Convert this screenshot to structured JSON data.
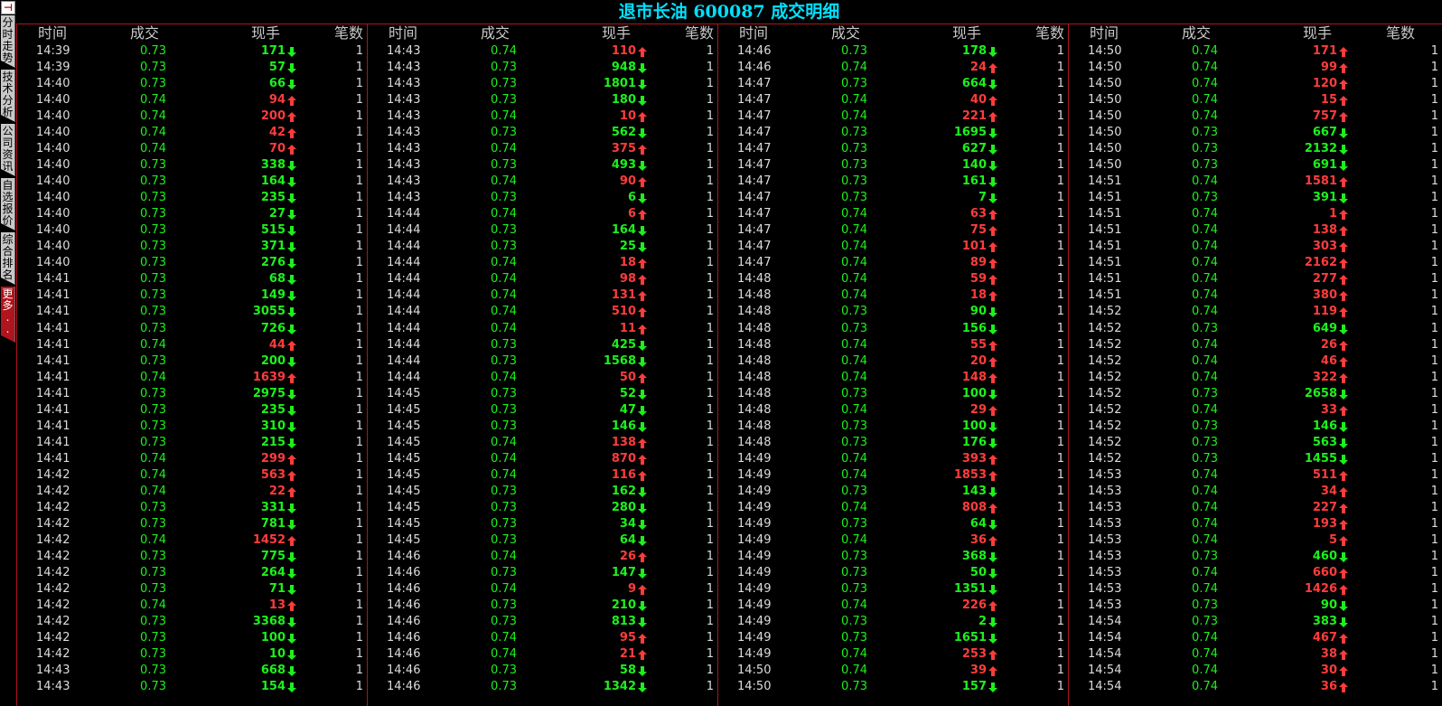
{
  "sidebar": {
    "tabs": [
      "分时走势",
      "技术分析",
      "公司资讯",
      "自选报价",
      "综合排名",
      "更多..."
    ]
  },
  "title": "退市长油 600087 成交明细",
  "headers": {
    "time": "时间",
    "price": "成交",
    "volume": "现手",
    "count": "笔数"
  },
  "colors": {
    "up": "#ff3c3c",
    "down": "#1df01d",
    "title": "#00e0ff",
    "separator": "#b0141c"
  },
  "columns": [
    [
      [
        "14:39",
        "0.73",
        "171",
        "down",
        "1"
      ],
      [
        "14:39",
        "0.73",
        "57",
        "down",
        "1"
      ],
      [
        "14:40",
        "0.73",
        "66",
        "down",
        "1"
      ],
      [
        "14:40",
        "0.74",
        "94",
        "up",
        "1"
      ],
      [
        "14:40",
        "0.74",
        "200",
        "up",
        "1"
      ],
      [
        "14:40",
        "0.74",
        "42",
        "up",
        "1"
      ],
      [
        "14:40",
        "0.74",
        "70",
        "up",
        "1"
      ],
      [
        "14:40",
        "0.73",
        "338",
        "down",
        "1"
      ],
      [
        "14:40",
        "0.73",
        "164",
        "down",
        "1"
      ],
      [
        "14:40",
        "0.73",
        "235",
        "down",
        "1"
      ],
      [
        "14:40",
        "0.73",
        "27",
        "down",
        "1"
      ],
      [
        "14:40",
        "0.73",
        "515",
        "down",
        "1"
      ],
      [
        "14:40",
        "0.73",
        "371",
        "down",
        "1"
      ],
      [
        "14:40",
        "0.73",
        "276",
        "down",
        "1"
      ],
      [
        "14:41",
        "0.73",
        "68",
        "down",
        "1"
      ],
      [
        "14:41",
        "0.73",
        "149",
        "down",
        "1"
      ],
      [
        "14:41",
        "0.73",
        "3055",
        "down",
        "1"
      ],
      [
        "14:41",
        "0.73",
        "726",
        "down",
        "1"
      ],
      [
        "14:41",
        "0.74",
        "44",
        "up",
        "1"
      ],
      [
        "14:41",
        "0.73",
        "200",
        "down",
        "1"
      ],
      [
        "14:41",
        "0.74",
        "1639",
        "up",
        "1"
      ],
      [
        "14:41",
        "0.73",
        "2975",
        "down",
        "1"
      ],
      [
        "14:41",
        "0.73",
        "235",
        "down",
        "1"
      ],
      [
        "14:41",
        "0.73",
        "310",
        "down",
        "1"
      ],
      [
        "14:41",
        "0.73",
        "215",
        "down",
        "1"
      ],
      [
        "14:41",
        "0.74",
        "299",
        "up",
        "1"
      ],
      [
        "14:42",
        "0.74",
        "563",
        "up",
        "1"
      ],
      [
        "14:42",
        "0.74",
        "22",
        "up",
        "1"
      ],
      [
        "14:42",
        "0.73",
        "331",
        "down",
        "1"
      ],
      [
        "14:42",
        "0.73",
        "781",
        "down",
        "1"
      ],
      [
        "14:42",
        "0.74",
        "1452",
        "up",
        "1"
      ],
      [
        "14:42",
        "0.73",
        "775",
        "down",
        "1"
      ],
      [
        "14:42",
        "0.73",
        "264",
        "down",
        "1"
      ],
      [
        "14:42",
        "0.73",
        "71",
        "down",
        "1"
      ],
      [
        "14:42",
        "0.74",
        "13",
        "up",
        "1"
      ],
      [
        "14:42",
        "0.73",
        "3368",
        "down",
        "1"
      ],
      [
        "14:42",
        "0.73",
        "100",
        "down",
        "1"
      ],
      [
        "14:42",
        "0.73",
        "10",
        "down",
        "1"
      ],
      [
        "14:43",
        "0.73",
        "668",
        "down",
        "1"
      ],
      [
        "14:43",
        "0.73",
        "154",
        "down",
        "1"
      ]
    ],
    [
      [
        "14:43",
        "0.74",
        "110",
        "up",
        "1"
      ],
      [
        "14:43",
        "0.73",
        "948",
        "down",
        "1"
      ],
      [
        "14:43",
        "0.73",
        "1801",
        "down",
        "1"
      ],
      [
        "14:43",
        "0.73",
        "180",
        "down",
        "1"
      ],
      [
        "14:43",
        "0.74",
        "10",
        "up",
        "1"
      ],
      [
        "14:43",
        "0.73",
        "562",
        "down",
        "1"
      ],
      [
        "14:43",
        "0.74",
        "375",
        "up",
        "1"
      ],
      [
        "14:43",
        "0.73",
        "493",
        "down",
        "1"
      ],
      [
        "14:43",
        "0.74",
        "90",
        "up",
        "1"
      ],
      [
        "14:43",
        "0.73",
        "6",
        "down",
        "1"
      ],
      [
        "14:44",
        "0.74",
        "6",
        "up",
        "1"
      ],
      [
        "14:44",
        "0.73",
        "164",
        "down",
        "1"
      ],
      [
        "14:44",
        "0.73",
        "25",
        "down",
        "1"
      ],
      [
        "14:44",
        "0.74",
        "18",
        "up",
        "1"
      ],
      [
        "14:44",
        "0.74",
        "98",
        "up",
        "1"
      ],
      [
        "14:44",
        "0.74",
        "131",
        "up",
        "1"
      ],
      [
        "14:44",
        "0.74",
        "510",
        "up",
        "1"
      ],
      [
        "14:44",
        "0.74",
        "11",
        "up",
        "1"
      ],
      [
        "14:44",
        "0.73",
        "425",
        "down",
        "1"
      ],
      [
        "14:44",
        "0.73",
        "1568",
        "down",
        "1"
      ],
      [
        "14:44",
        "0.74",
        "50",
        "up",
        "1"
      ],
      [
        "14:45",
        "0.73",
        "52",
        "down",
        "1"
      ],
      [
        "14:45",
        "0.73",
        "47",
        "down",
        "1"
      ],
      [
        "14:45",
        "0.73",
        "146",
        "down",
        "1"
      ],
      [
        "14:45",
        "0.74",
        "138",
        "up",
        "1"
      ],
      [
        "14:45",
        "0.74",
        "870",
        "up",
        "1"
      ],
      [
        "14:45",
        "0.74",
        "116",
        "up",
        "1"
      ],
      [
        "14:45",
        "0.73",
        "162",
        "down",
        "1"
      ],
      [
        "14:45",
        "0.73",
        "280",
        "down",
        "1"
      ],
      [
        "14:45",
        "0.73",
        "34",
        "down",
        "1"
      ],
      [
        "14:45",
        "0.73",
        "64",
        "down",
        "1"
      ],
      [
        "14:46",
        "0.74",
        "26",
        "up",
        "1"
      ],
      [
        "14:46",
        "0.73",
        "147",
        "down",
        "1"
      ],
      [
        "14:46",
        "0.74",
        "9",
        "up",
        "1"
      ],
      [
        "14:46",
        "0.73",
        "210",
        "down",
        "1"
      ],
      [
        "14:46",
        "0.73",
        "813",
        "down",
        "1"
      ],
      [
        "14:46",
        "0.74",
        "95",
        "up",
        "1"
      ],
      [
        "14:46",
        "0.74",
        "21",
        "up",
        "1"
      ],
      [
        "14:46",
        "0.73",
        "58",
        "down",
        "1"
      ],
      [
        "14:46",
        "0.73",
        "1342",
        "down",
        "1"
      ]
    ],
    [
      [
        "14:46",
        "0.73",
        "178",
        "down",
        "1"
      ],
      [
        "14:46",
        "0.74",
        "24",
        "up",
        "1"
      ],
      [
        "14:47",
        "0.73",
        "664",
        "down",
        "1"
      ],
      [
        "14:47",
        "0.74",
        "40",
        "up",
        "1"
      ],
      [
        "14:47",
        "0.74",
        "221",
        "up",
        "1"
      ],
      [
        "14:47",
        "0.73",
        "1695",
        "down",
        "1"
      ],
      [
        "14:47",
        "0.73",
        "627",
        "down",
        "1"
      ],
      [
        "14:47",
        "0.73",
        "140",
        "down",
        "1"
      ],
      [
        "14:47",
        "0.73",
        "161",
        "down",
        "1"
      ],
      [
        "14:47",
        "0.73",
        "7",
        "down",
        "1"
      ],
      [
        "14:47",
        "0.74",
        "63",
        "up",
        "1"
      ],
      [
        "14:47",
        "0.74",
        "75",
        "up",
        "1"
      ],
      [
        "14:47",
        "0.74",
        "101",
        "up",
        "1"
      ],
      [
        "14:47",
        "0.74",
        "89",
        "up",
        "1"
      ],
      [
        "14:48",
        "0.74",
        "59",
        "up",
        "1"
      ],
      [
        "14:48",
        "0.74",
        "18",
        "up",
        "1"
      ],
      [
        "14:48",
        "0.73",
        "90",
        "down",
        "1"
      ],
      [
        "14:48",
        "0.73",
        "156",
        "down",
        "1"
      ],
      [
        "14:48",
        "0.74",
        "55",
        "up",
        "1"
      ],
      [
        "14:48",
        "0.74",
        "20",
        "up",
        "1"
      ],
      [
        "14:48",
        "0.74",
        "148",
        "up",
        "1"
      ],
      [
        "14:48",
        "0.73",
        "100",
        "down",
        "1"
      ],
      [
        "14:48",
        "0.74",
        "29",
        "up",
        "1"
      ],
      [
        "14:48",
        "0.73",
        "100",
        "down",
        "1"
      ],
      [
        "14:48",
        "0.73",
        "176",
        "down",
        "1"
      ],
      [
        "14:49",
        "0.74",
        "393",
        "up",
        "1"
      ],
      [
        "14:49",
        "0.74",
        "1853",
        "up",
        "1"
      ],
      [
        "14:49",
        "0.73",
        "143",
        "down",
        "1"
      ],
      [
        "14:49",
        "0.74",
        "808",
        "up",
        "1"
      ],
      [
        "14:49",
        "0.73",
        "64",
        "down",
        "1"
      ],
      [
        "14:49",
        "0.74",
        "36",
        "up",
        "1"
      ],
      [
        "14:49",
        "0.73",
        "368",
        "down",
        "1"
      ],
      [
        "14:49",
        "0.73",
        "50",
        "down",
        "1"
      ],
      [
        "14:49",
        "0.73",
        "1351",
        "down",
        "1"
      ],
      [
        "14:49",
        "0.74",
        "226",
        "up",
        "1"
      ],
      [
        "14:49",
        "0.73",
        "2",
        "down",
        "1"
      ],
      [
        "14:49",
        "0.73",
        "1651",
        "down",
        "1"
      ],
      [
        "14:49",
        "0.74",
        "253",
        "up",
        "1"
      ],
      [
        "14:50",
        "0.74",
        "39",
        "up",
        "1"
      ],
      [
        "14:50",
        "0.73",
        "157",
        "down",
        "1"
      ]
    ],
    [
      [
        "14:50",
        "0.74",
        "171",
        "up",
        "1"
      ],
      [
        "14:50",
        "0.74",
        "99",
        "up",
        "1"
      ],
      [
        "14:50",
        "0.74",
        "120",
        "up",
        "1"
      ],
      [
        "14:50",
        "0.74",
        "15",
        "up",
        "1"
      ],
      [
        "14:50",
        "0.74",
        "757",
        "up",
        "1"
      ],
      [
        "14:50",
        "0.73",
        "667",
        "down",
        "1"
      ],
      [
        "14:50",
        "0.73",
        "2132",
        "down",
        "1"
      ],
      [
        "14:50",
        "0.73",
        "691",
        "down",
        "1"
      ],
      [
        "14:51",
        "0.74",
        "1581",
        "up",
        "1"
      ],
      [
        "14:51",
        "0.73",
        "391",
        "down",
        "1"
      ],
      [
        "14:51",
        "0.74",
        "1",
        "up",
        "1"
      ],
      [
        "14:51",
        "0.74",
        "138",
        "up",
        "1"
      ],
      [
        "14:51",
        "0.74",
        "303",
        "up",
        "1"
      ],
      [
        "14:51",
        "0.74",
        "2162",
        "up",
        "1"
      ],
      [
        "14:51",
        "0.74",
        "277",
        "up",
        "1"
      ],
      [
        "14:51",
        "0.74",
        "380",
        "up",
        "1"
      ],
      [
        "14:52",
        "0.74",
        "119",
        "up",
        "1"
      ],
      [
        "14:52",
        "0.73",
        "649",
        "down",
        "1"
      ],
      [
        "14:52",
        "0.74",
        "26",
        "up",
        "1"
      ],
      [
        "14:52",
        "0.74",
        "46",
        "up",
        "1"
      ],
      [
        "14:52",
        "0.74",
        "322",
        "up",
        "1"
      ],
      [
        "14:52",
        "0.73",
        "2658",
        "down",
        "1"
      ],
      [
        "14:52",
        "0.74",
        "33",
        "up",
        "1"
      ],
      [
        "14:52",
        "0.73",
        "146",
        "down",
        "1"
      ],
      [
        "14:52",
        "0.73",
        "563",
        "down",
        "1"
      ],
      [
        "14:52",
        "0.73",
        "1455",
        "down",
        "1"
      ],
      [
        "14:53",
        "0.74",
        "511",
        "up",
        "1"
      ],
      [
        "14:53",
        "0.74",
        "34",
        "up",
        "1"
      ],
      [
        "14:53",
        "0.74",
        "227",
        "up",
        "1"
      ],
      [
        "14:53",
        "0.74",
        "193",
        "up",
        "1"
      ],
      [
        "14:53",
        "0.74",
        "5",
        "up",
        "1"
      ],
      [
        "14:53",
        "0.73",
        "460",
        "down",
        "1"
      ],
      [
        "14:53",
        "0.74",
        "660",
        "up",
        "1"
      ],
      [
        "14:53",
        "0.74",
        "1426",
        "up",
        "1"
      ],
      [
        "14:53",
        "0.73",
        "90",
        "down",
        "1"
      ],
      [
        "14:54",
        "0.73",
        "383",
        "down",
        "1"
      ],
      [
        "14:54",
        "0.74",
        "467",
        "up",
        "1"
      ],
      [
        "14:54",
        "0.74",
        "38",
        "up",
        "1"
      ],
      [
        "14:54",
        "0.74",
        "30",
        "up",
        "1"
      ],
      [
        "14:54",
        "0.74",
        "36",
        "up",
        "1"
      ]
    ]
  ]
}
